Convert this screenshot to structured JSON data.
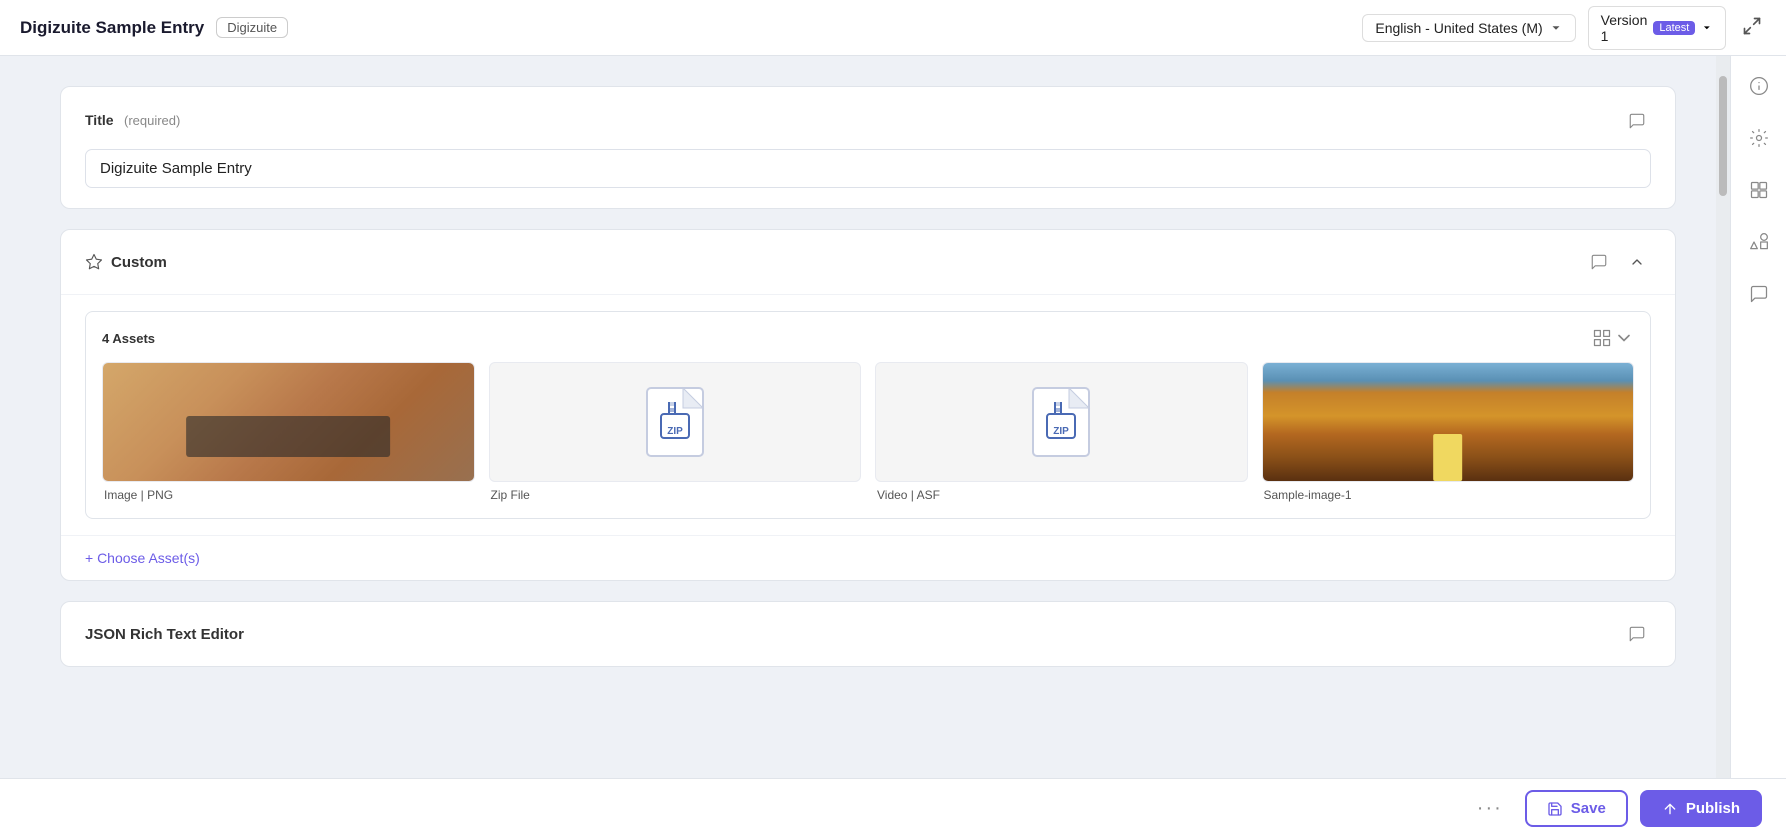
{
  "header": {
    "title": "Digizuite Sample Entry",
    "org_label": "Digizuite",
    "language": "English - United States (M)",
    "version": "Version 1",
    "version_badge": "Latest"
  },
  "title_field": {
    "label": "Title",
    "required_text": "(required)",
    "value": "Digizuite Sample Entry"
  },
  "custom_section": {
    "label": "Custom",
    "assets_count": "4 Assets",
    "assets": [
      {
        "type": "image",
        "label": "Image | PNG"
      },
      {
        "type": "zip",
        "label": "Zip File"
      },
      {
        "type": "zip",
        "label": "Video | ASF"
      },
      {
        "type": "image_road",
        "label": "Sample-image-1"
      }
    ],
    "choose_assets_label": "+ Choose Asset(s)"
  },
  "json_section": {
    "label": "JSON Rich Text Editor"
  },
  "footer": {
    "more_icon": "···",
    "save_label": "Save",
    "publish_label": "Publish"
  },
  "sidebar": {
    "icons": [
      "info-icon",
      "settings-icon",
      "structure-icon",
      "shapes-icon",
      "chat-icon"
    ]
  }
}
